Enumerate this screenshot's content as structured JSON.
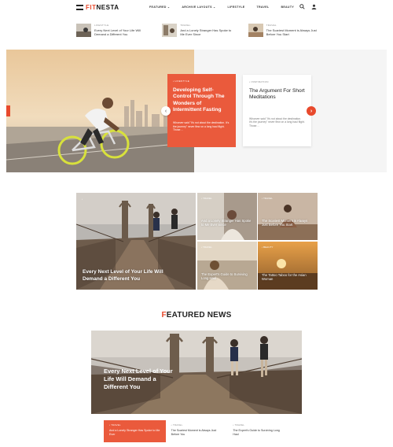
{
  "brand": {
    "logo_prefix": "FIT",
    "logo_suffix": "NESTA",
    "accent": "#e8492c"
  },
  "nav": {
    "items": [
      {
        "label": "FEATURED ⌄"
      },
      {
        "label": "ARCHIVE LAYOUTS ⌄"
      },
      {
        "label": "LIFESTYLE"
      },
      {
        "label": "TRAVEL"
      },
      {
        "label": "BEAUTY"
      }
    ]
  },
  "strip": [
    {
      "category": "LIFESTYLE",
      "title": "Every Next Level of Your Life Will Demand a Different You"
    },
    {
      "category": "TRAVEL",
      "title": "And a Lonely Stranger Has Spoke to Me Ever Since"
    },
    {
      "category": "TRAVEL",
      "title": "The Scariest Moment is Always Just Before You Start"
    }
  ],
  "hero": {
    "card1": {
      "category": "• LIFESTYLE",
      "title": "Developing Self-Control Through The Wonders of Intermittent Fasting",
      "excerpt": "Whoever said \"It's not about the destination. It's the journey\" never flew on a long haul flight. Those…"
    },
    "card2": {
      "category": "• INSPIRATION",
      "title": "The Argument For Short Meditations",
      "excerpt": "Whoever said \"It's not about the destination. It's the journey\" never flew on a long haul flight. Those…"
    },
    "prev_icon": "‹",
    "next_icon": "›"
  },
  "grid": {
    "big": {
      "title": "Every Next Level of Your Life Will Demand a Different You"
    },
    "tiles": [
      {
        "category": "• TRAVEL",
        "title": "And a Lonely Stranger Has Spoke to Me Ever Since"
      },
      {
        "category": "• TRAVEL",
        "title": "The Scariest Moment is Always Just Before You Start"
      },
      {
        "category": "• TRAVEL",
        "title": "The Expert's Guide to Surviving Long Haul"
      },
      {
        "category": "• BEAUTY",
        "title": "The Tattoo Taboo for the Asian Woman"
      }
    ]
  },
  "featured": {
    "title_first": "F",
    "title_rest": "EATURED NEWS",
    "headline": "Every Next Level of Your Life Will Demand a Different You",
    "cards": [
      {
        "category": "• TRAVEL",
        "title": "And a Lonely Stranger Has Spoke to Me Ever"
      },
      {
        "category": "• TRAVEL",
        "title": "The Scariest Moment is Always Just Before You"
      },
      {
        "category": "• TRAVEL",
        "title": "The Expert's Guide to Surviving Long Haul"
      }
    ]
  }
}
